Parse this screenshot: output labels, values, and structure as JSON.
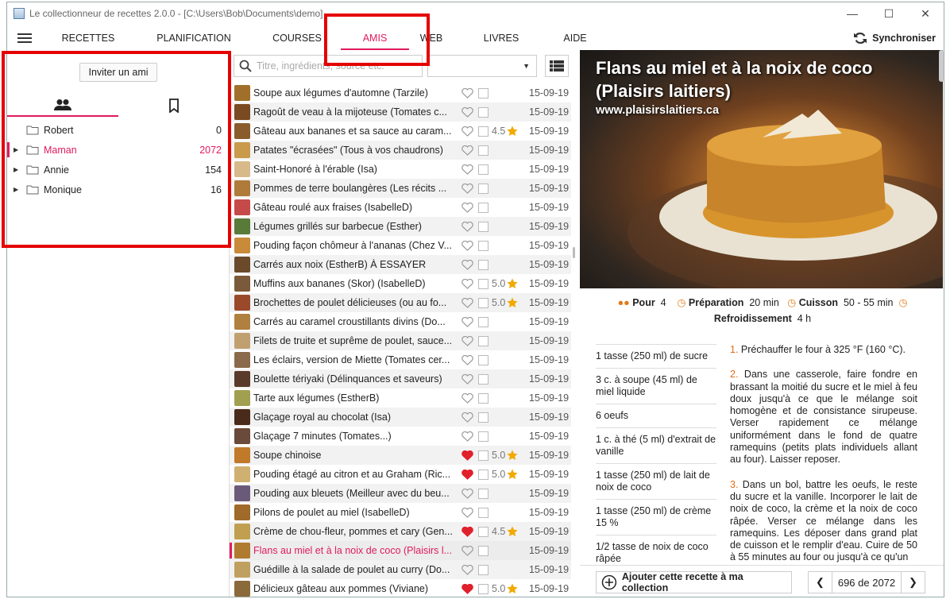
{
  "app": {
    "title": "Le collectionneur de recettes 2.0.0 -  [C:\\Users\\Bob\\Documents\\demo]",
    "accent": "#e01b5e"
  },
  "menu": {
    "tabs": [
      "RECETTES",
      "PLANIFICATION",
      "COURSES",
      "AMIS",
      "WEB",
      "LIVRES",
      "AIDE"
    ],
    "active": "AMIS",
    "sync_label": "Synchroniser"
  },
  "friends": {
    "invite_label": "Inviter un ami",
    "tabs": [
      "friends-icon",
      "bookmark-icon"
    ],
    "items": [
      {
        "name": "Robert",
        "count": "0",
        "expandable": false
      },
      {
        "name": "Maman",
        "count": "2072",
        "expandable": true,
        "selected": true
      },
      {
        "name": "Annie",
        "count": "154",
        "expandable": true
      },
      {
        "name": "Monique",
        "count": "16",
        "expandable": true
      }
    ]
  },
  "search": {
    "placeholder": "Titre, ingrédients, source etc."
  },
  "recipes": [
    {
      "title": "Soupe aux légumes d'automne (Tarzile)",
      "fav": false,
      "rating": "",
      "date": "15-09-19",
      "thumb": "#a0702a"
    },
    {
      "title": "Ragoût de veau à la mijoteuse (Tomates c...",
      "fav": false,
      "rating": "",
      "date": "15-09-19",
      "thumb": "#7a4a22"
    },
    {
      "title": "Gâteau aux bananes et sa sauce au caram...",
      "fav": false,
      "rating": "4.5",
      "date": "15-09-19",
      "thumb": "#8a5c2c"
    },
    {
      "title": "Patates \"écrasées\" (Tous à vos chaudrons)",
      "fav": false,
      "rating": "",
      "date": "15-09-19",
      "thumb": "#c89a4a"
    },
    {
      "title": "Saint-Honoré à l'érable (Isa)",
      "fav": false,
      "rating": "",
      "date": "15-09-19",
      "thumb": "#d7b98a"
    },
    {
      "title": "Pommes de terre boulangères (Les récits ...",
      "fav": false,
      "rating": "",
      "date": "15-09-19",
      "thumb": "#b07a3a"
    },
    {
      "title": "Gâteau roulé aux fraises (IsabelleD)",
      "fav": false,
      "rating": "",
      "date": "15-09-19",
      "thumb": "#c74a4a"
    },
    {
      "title": "Légumes grillés sur barbecue (Esther)",
      "fav": false,
      "rating": "",
      "date": "15-09-19",
      "thumb": "#5a7a3a"
    },
    {
      "title": "Pouding façon chômeur à l'ananas (Chez V...",
      "fav": false,
      "rating": "",
      "date": "15-09-19",
      "thumb": "#c98a3a"
    },
    {
      "title": "Carrés aux noix (EstherB) À ESSAYER",
      "fav": false,
      "rating": "",
      "date": "15-09-19",
      "thumb": "#6a4a2a"
    },
    {
      "title": "Muffins aux bananes (Skor) (IsabelleD)",
      "fav": false,
      "rating": "5.0",
      "date": "15-09-19",
      "thumb": "#7a5a3a"
    },
    {
      "title": "Brochettes de poulet délicieuses (ou au fo...",
      "fav": false,
      "rating": "5.0",
      "date": "15-09-19",
      "thumb": "#9a4a2a"
    },
    {
      "title": "Carrés au caramel croustillants divins (Do...",
      "fav": false,
      "rating": "",
      "date": "15-09-19",
      "thumb": "#b08040"
    },
    {
      "title": "Filets de truite et suprême de poulet, sauce...",
      "fav": false,
      "rating": "",
      "date": "15-09-19",
      "thumb": "#c0a070"
    },
    {
      "title": "Les éclairs, version de Miette (Tomates cer...",
      "fav": false,
      "rating": "",
      "date": "15-09-19",
      "thumb": "#8a6a4a"
    },
    {
      "title": "Boulette tériyaki (Délinquances et saveurs)",
      "fav": false,
      "rating": "",
      "date": "15-09-19",
      "thumb": "#5a3a2a"
    },
    {
      "title": "Tarte aux légumes (EstherB)",
      "fav": false,
      "rating": "",
      "date": "15-09-19",
      "thumb": "#a0a050"
    },
    {
      "title": "Glaçage royal au chocolat (Isa)",
      "fav": false,
      "rating": "",
      "date": "15-09-19",
      "thumb": "#4a2a1a"
    },
    {
      "title": "Glaçage 7 minutes (Tomates...)",
      "fav": false,
      "rating": "",
      "date": "15-09-19",
      "thumb": "#6a4a3a"
    },
    {
      "title": "Soupe chinoise",
      "fav": true,
      "rating": "5.0",
      "date": "15-09-19",
      "thumb": "#c07a2a"
    },
    {
      "title": "Pouding étagé au citron et au Graham (Ric...",
      "fav": true,
      "rating": "5.0",
      "date": "15-09-19",
      "thumb": "#d0b070"
    },
    {
      "title": "Pouding aux bleuets (Meilleur avec du beu...",
      "fav": false,
      "rating": "",
      "date": "15-09-19",
      "thumb": "#6a5a7a"
    },
    {
      "title": "Pilons de poulet au miel (IsabelleD)",
      "fav": false,
      "rating": "",
      "date": "15-09-19",
      "thumb": "#a06a2a"
    },
    {
      "title": "Crème de chou-fleur, pommes et cary (Gen...",
      "fav": true,
      "rating": "4.5",
      "date": "15-09-19",
      "thumb": "#c0a050"
    },
    {
      "title": "Flans au miel et à la noix de coco (Plaisirs l...",
      "fav": false,
      "rating": "",
      "date": "15-09-19",
      "thumb": "#b07a30",
      "selected": true
    },
    {
      "title": "Guédille à la salade de poulet au curry (Do...",
      "fav": false,
      "rating": "",
      "date": "15-09-19",
      "thumb": "#c0a060"
    },
    {
      "title": "Délicieux gâteau aux pommes (Viviane)",
      "fav": true,
      "rating": "5.0",
      "date": "15-09-19",
      "thumb": "#8a6a3a"
    }
  ],
  "detail": {
    "title": "Flans au miel et à la noix de coco (Plaisirs laitiers)",
    "site": "www.plaisirslaitiers.ca",
    "serves_label": "Pour",
    "serves": "4",
    "prep_label": "Préparation",
    "prep": "20 min",
    "cook_label": "Cuisson",
    "cook": "50 - 55 min",
    "cool_label": "Refroidissement",
    "cool": "4 h",
    "ingredients": [
      "1 tasse (250 ml) de sucre",
      "3 c. à soupe (45 ml) de miel liquide",
      "6 oeufs",
      "1 c. à thé (5 ml) d'extrait de vanille",
      "1 tasse (250 ml) de lait de noix de coco",
      "1 tasse (250 ml) de crème 15 %",
      "1/2 tasse de noix de coco râpée"
    ],
    "steps": [
      {
        "n": "1.",
        "text": "Préchauffer le four à 325 °F (160 °C)."
      },
      {
        "n": "2.",
        "text": "Dans une casserole, faire fondre en brassant la moitié du sucre et le miel à feu doux jusqu'à ce que le mélange soit homogène et de consistance sirupeuse. Verser rapidement ce mélange uniformément dans le fond de quatre ramequins (petits plats individuels allant au four). Laisser reposer."
      },
      {
        "n": "3.",
        "text": "Dans un bol, battre les oeufs, le reste du sucre et la vanille. Incorporer le lait de noix de coco, la crème et la noix de coco râpée. Verser ce mélange dans les ramequins. Les déposer dans grand plat de cuisson et le remplir d'eau. Cuire de 50 à 55 minutes au four ou jusqu'à ce qu'un"
      }
    ],
    "add_label": "Ajouter cette recette à ma collection",
    "pager": "696 de 2072"
  },
  "icons": {
    "heart_on": "#e0202a",
    "star": "#f2a900",
    "orange": "#e07a1a"
  }
}
